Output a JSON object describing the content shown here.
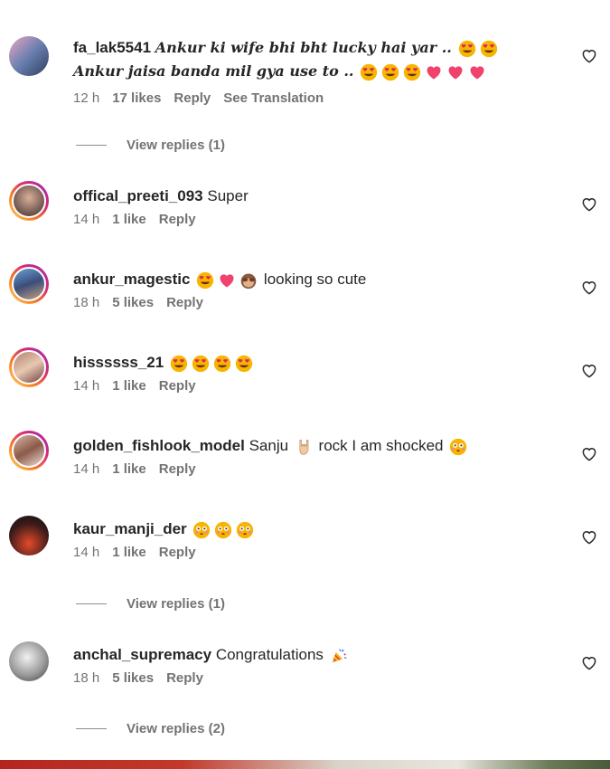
{
  "top_cut_text": "",
  "comments": [
    {
      "user": "fa_lak5541",
      "line1": "Ankur ki wife bhi bht lucky hai yar ..",
      "line2": "Ankur jaisa banda mil gya use to ..",
      "time": "12 h",
      "likes": "17 likes",
      "reply": "Reply",
      "translate": "See Translation",
      "replies": "View replies (1)"
    },
    {
      "user": "offical_preeti_093",
      "text": "Super",
      "time": "14 h",
      "likes": "1 like",
      "reply": "Reply"
    },
    {
      "user": "ankur_magestic",
      "text": "looking so cute",
      "time": "18 h",
      "likes": "5 likes",
      "reply": "Reply"
    },
    {
      "user": "hissssss_21",
      "text": "",
      "time": "14 h",
      "likes": "1 like",
      "reply": "Reply"
    },
    {
      "user": "golden_fishlook_model",
      "text": "Sanju",
      "text2": "rock I am shocked",
      "time": "14 h",
      "likes": "1 like",
      "reply": "Reply"
    },
    {
      "user": "kaur_manji_der",
      "text": "",
      "time": "14 h",
      "likes": "1 like",
      "reply": "Reply",
      "replies": "View replies (1)"
    },
    {
      "user": "anchal_supremacy",
      "text": "Congratulations",
      "time": "18 h",
      "likes": "5 likes",
      "reply": "Reply",
      "replies": "View replies (2)"
    }
  ],
  "colors": {
    "text": "#262626",
    "meta": "#737373",
    "heart_eyes": "#f7b500",
    "heart": "#f0426a"
  },
  "icons": [
    "heart-outline-icon",
    "smiling-face-with-heart-eyes-emoji",
    "pink-heart-emoji",
    "see-no-evil-monkey-emoji",
    "rock-on-hand-emoji",
    "flushed-face-emoji",
    "party-popper-emoji"
  ]
}
